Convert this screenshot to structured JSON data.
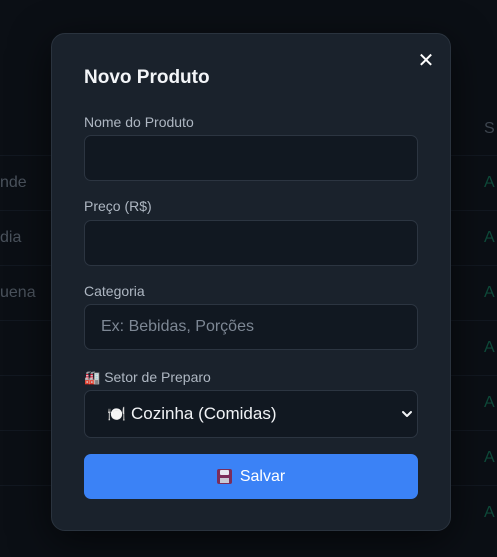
{
  "background": {
    "column_header": "S",
    "rows": [
      {
        "left": "nde",
        "right": "A"
      },
      {
        "left": "dia",
        "right": "A"
      },
      {
        "left": "uena",
        "right": "A"
      },
      {
        "left": "",
        "right": "A"
      },
      {
        "left": "",
        "right": "A"
      },
      {
        "left": "",
        "right": "A"
      },
      {
        "left": "",
        "right": "A"
      }
    ]
  },
  "modal": {
    "title": "Novo Produto",
    "close_label": "✕",
    "fields": {
      "name": {
        "label": "Nome do Produto",
        "value": "",
        "placeholder": ""
      },
      "price": {
        "label": "Preço (R$)",
        "value": "",
        "placeholder": ""
      },
      "category": {
        "label": "Categoria",
        "value": "",
        "placeholder": "Ex: Bebidas, Porções"
      },
      "sector": {
        "label_icon": "🏭",
        "label": "Setor de Preparo",
        "selected_icon": "🍽️",
        "selected": "Cozinha (Comidas)"
      }
    },
    "save_button": {
      "icon": "floppy-disk-icon",
      "label": "Salvar"
    }
  },
  "colors": {
    "accent": "#3b82f6",
    "modal_bg": "#1a222c",
    "input_bg": "#111821",
    "status_green": "#0e4a3a"
  }
}
